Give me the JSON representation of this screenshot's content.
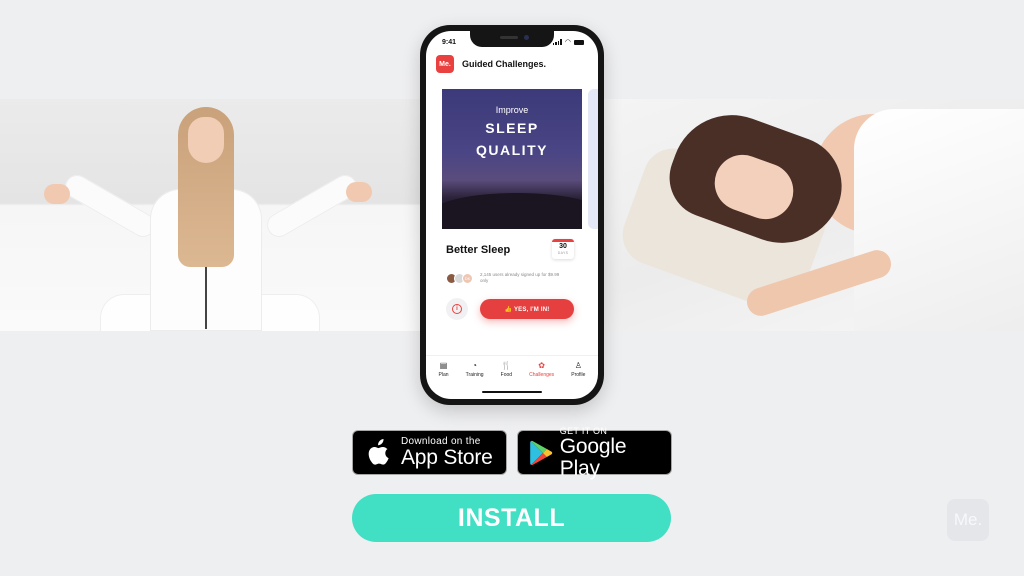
{
  "phone": {
    "status_time": "9:41",
    "app_logo": "Me.",
    "app_title": "Guided Challenges.",
    "hero": {
      "subtitle": "Improve",
      "line1": "SLEEP",
      "line2": "QUALITY"
    },
    "challenge": {
      "title": "Better Sleep",
      "days_number": "30",
      "days_label": "DAYS",
      "signup_text": "2,145 users already signed up for $9.99 only",
      "avatar_initials": "DK",
      "cta_label": "👍 YES, I'M IN!"
    },
    "tabs": [
      {
        "label": "Plan",
        "icon": "plan-icon",
        "glyph": "▤",
        "active": false
      },
      {
        "label": "Training",
        "icon": "training-icon",
        "glyph": "◔",
        "active": false
      },
      {
        "label": "Food",
        "icon": "food-icon",
        "glyph": "🍴",
        "active": false
      },
      {
        "label": "Challenges",
        "icon": "challenges-icon",
        "glyph": "✿",
        "active": true
      },
      {
        "label": "Profile",
        "icon": "profile-icon",
        "glyph": "♙",
        "active": false
      }
    ]
  },
  "badges": {
    "apple": {
      "small": "Download on the",
      "big": "App Store"
    },
    "google": {
      "small": "GET IT ON",
      "big": "Google Play"
    }
  },
  "install_label": "INSTALL",
  "watermark": "Me.",
  "colors": {
    "brand_red": "#e8413f",
    "install_teal": "#41dfc3",
    "background": "#eeeff1"
  }
}
